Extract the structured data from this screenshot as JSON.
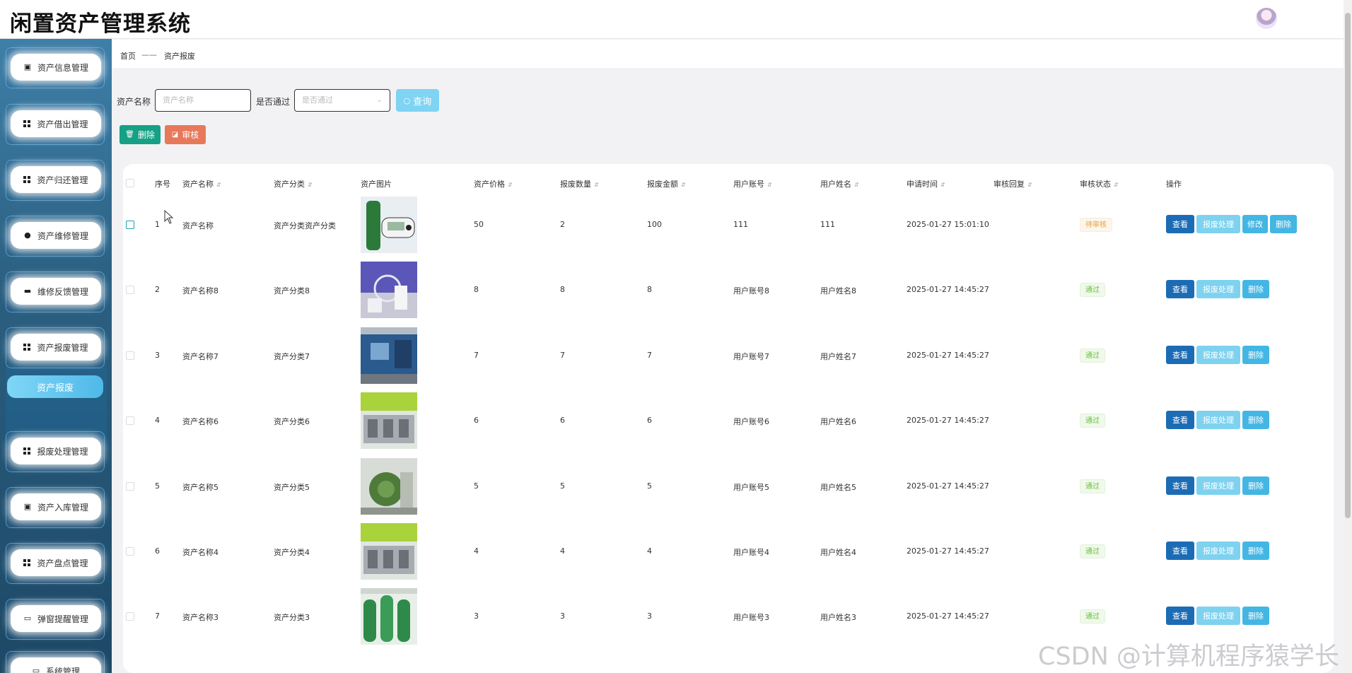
{
  "app": {
    "title": "闲置资产管理系统"
  },
  "sidebar": {
    "items": [
      {
        "label": "资产信息管理",
        "icon": "clipboard-icon"
      },
      {
        "label": "资产借出管理",
        "icon": "grid-icon"
      },
      {
        "label": "资产归还管理",
        "icon": "grid-icon"
      },
      {
        "label": "资产维修管理",
        "icon": "user-icon"
      },
      {
        "label": "维修反馈管理",
        "icon": "chat-icon"
      },
      {
        "label": "资产报废管理",
        "icon": "grid-icon"
      },
      {
        "label": "报废处理管理",
        "icon": "grid-icon"
      },
      {
        "label": "资产入库管理",
        "icon": "clipboard-icon"
      },
      {
        "label": "资产盘点管理",
        "icon": "grid-icon"
      },
      {
        "label": "弹窗提醒管理",
        "icon": "monitor-icon"
      },
      {
        "label": "系统管理",
        "icon": "monitor-icon"
      }
    ],
    "active_sub": "资产报废"
  },
  "breadcrumb": {
    "home": "首页",
    "sep": "——",
    "current": "资产报废"
  },
  "filters": {
    "name_label": "资产名称",
    "name_placeholder": "资产名称",
    "pass_label": "是否通过",
    "pass_placeholder": "是否通过",
    "query_label": "查询"
  },
  "actions": {
    "delete_label": "删除",
    "audit_label": "审核"
  },
  "table": {
    "headers": {
      "index": "序号",
      "name": "资产名称",
      "category": "资产分类",
      "image": "资产图片",
      "price": "资产价格",
      "qty": "报废数量",
      "amount": "报废金额",
      "account": "用户账号",
      "user": "用户姓名",
      "time": "申请时间",
      "reply": "审核回复",
      "status": "审核状态",
      "ops": "操作"
    },
    "rows": [
      {
        "index": "1",
        "name": "资产名称",
        "category": "资产分类资产分类",
        "price": "50",
        "qty": "2",
        "amount": "100",
        "account": "111",
        "user": "111",
        "time": "2025-01-27 15:01:10",
        "status": "待审核",
        "status_type": "pending",
        "img": "thermometer"
      },
      {
        "index": "2",
        "name": "资产名称8",
        "category": "资产分类8",
        "price": "8",
        "qty": "8",
        "amount": "8",
        "account": "用户账号8",
        "user": "用户姓名8",
        "time": "2025-01-27 14:45:27",
        "status": "通过",
        "status_type": "pass",
        "img": "lab"
      },
      {
        "index": "3",
        "name": "资产名称7",
        "category": "资产分类7",
        "price": "7",
        "qty": "7",
        "amount": "7",
        "account": "用户账号7",
        "user": "用户姓名7",
        "time": "2025-01-27 14:45:27",
        "status": "通过",
        "status_type": "pass",
        "img": "machine-blue"
      },
      {
        "index": "4",
        "name": "资产名称6",
        "category": "资产分类6",
        "price": "6",
        "qty": "6",
        "amount": "6",
        "account": "用户账号6",
        "user": "用户姓名6",
        "time": "2025-01-27 14:45:27",
        "status": "通过",
        "status_type": "pass",
        "img": "kitchen"
      },
      {
        "index": "5",
        "name": "资产名称5",
        "category": "资产分类5",
        "price": "5",
        "qty": "5",
        "amount": "5",
        "account": "用户账号5",
        "user": "用户姓名5",
        "time": "2025-01-27 14:45:27",
        "status": "通过",
        "status_type": "pass",
        "img": "machine-green"
      },
      {
        "index": "6",
        "name": "资产名称4",
        "category": "资产分类4",
        "price": "4",
        "qty": "4",
        "amount": "4",
        "account": "用户账号4",
        "user": "用户姓名4",
        "time": "2025-01-27 14:45:27",
        "status": "通过",
        "status_type": "pass",
        "img": "kitchen"
      },
      {
        "index": "7",
        "name": "资产名称3",
        "category": "资产分类3",
        "price": "3",
        "qty": "3",
        "amount": "3",
        "account": "用户账号3",
        "user": "用户姓名3",
        "time": "2025-01-27 14:45:27",
        "status": "通过",
        "status_type": "pass",
        "img": "tanks"
      }
    ],
    "op_labels": {
      "view": "查看",
      "handle": "报废处理",
      "edit": "修改",
      "delete": "删除"
    }
  },
  "watermark": "CSDN @计算机程序猿学长",
  "colors": {
    "sidebar": "#2b5f80",
    "primary": "#1c6cb5",
    "light": "#7ed2ef",
    "delete_btn": "#16a085",
    "audit_btn": "#e8785a"
  }
}
